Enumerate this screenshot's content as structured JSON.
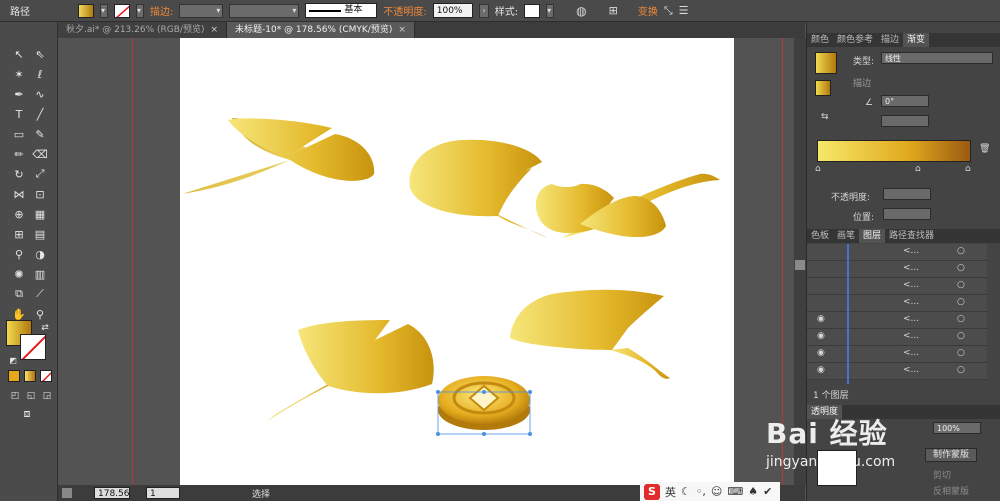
{
  "control_bar": {
    "path_label": "路径",
    "stroke_label": "描边:",
    "stroke_style": "基本",
    "opacity_label": "不透明度:",
    "opacity_value": "100%",
    "style_label": "样式:",
    "transform_label": "变换"
  },
  "doc_tabs": [
    {
      "label": "秋夕.ai* @ 213.26% (RGB/预览)",
      "close": "×"
    },
    {
      "label": "未标题-10* @ 178.56% (CMYK/预览)",
      "close": "×"
    }
  ],
  "status_bar": {
    "zoom": "178.56",
    "artboard_num": "1",
    "tool_name": "选择"
  },
  "gradient_panel": {
    "tabs": [
      "颜色",
      "颜色参考",
      "描边",
      "渐变"
    ],
    "type_label": "类型:",
    "type_value": "线性",
    "stroke_label": "描边",
    "angle_value": "0°",
    "opacity_label": "不透明度:",
    "location_label": "位置:"
  },
  "layers_panel": {
    "tabs": [
      "色板",
      "画笔",
      "图层",
      "路径查找器"
    ],
    "row_label": "<...",
    "layer_count": "1 个图层"
  },
  "transparency_panel": {
    "title": "透明度",
    "opacity_value": "100%",
    "make_mask": "制作蒙版",
    "clip": "剪切",
    "invert_mask": "反相蒙版"
  },
  "ime": {
    "lang": "英",
    "brand": "S"
  },
  "watermark": {
    "text": "Bai 经验",
    "url": "jingyan.baidu.com"
  },
  "colors": {
    "gold_light": "#f2e060",
    "gold_dark": "#c8930e",
    "grad_mid": "#e0a91c",
    "grad_end": "#9a5a12",
    "guide": "#b23a3a",
    "accent_blue": "#4a90e2"
  }
}
